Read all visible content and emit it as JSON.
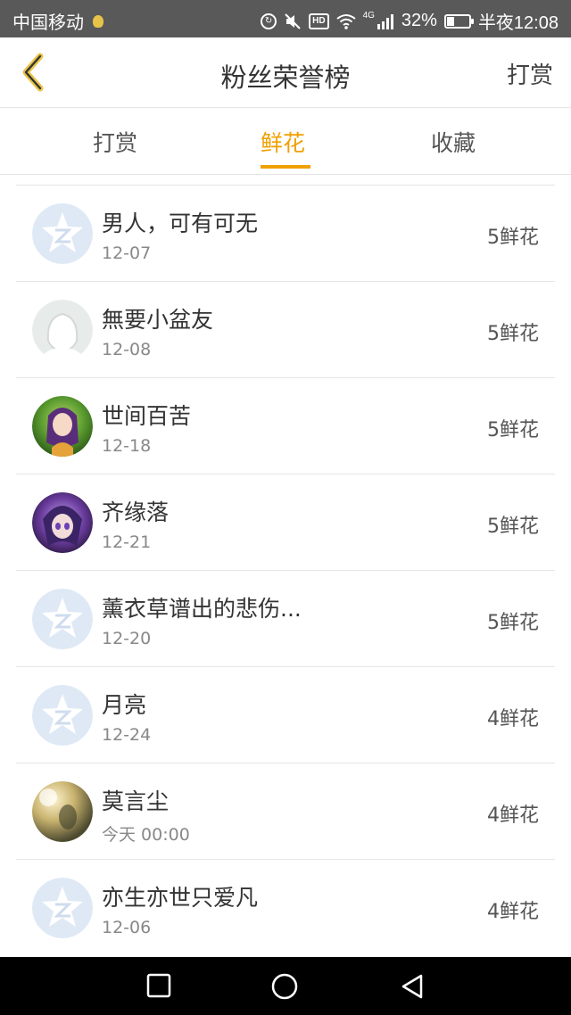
{
  "status_bar": {
    "carrier": "中国移动",
    "network": "4G",
    "battery": "32%",
    "battery_fraction": 0.32,
    "time": "半夜12:08"
  },
  "header": {
    "title": "粉丝荣誉榜",
    "right_action": "打赏"
  },
  "tabs": [
    {
      "label": "打赏",
      "active": false
    },
    {
      "label": "鲜花",
      "active": true
    },
    {
      "label": "收藏",
      "active": false
    }
  ],
  "list": [
    {
      "name": "男人，可有可无",
      "date": "12-07",
      "amount": "5鲜花",
      "avatar": "default-qq"
    },
    {
      "name": "無要小盆友",
      "date": "12-08",
      "amount": "5鲜花",
      "avatar": "silhouette"
    },
    {
      "name": "世间百苦",
      "date": "12-18",
      "amount": "5鲜花",
      "avatar": "anime-green"
    },
    {
      "name": "齐缘落",
      "date": "12-21",
      "amount": "5鲜花",
      "avatar": "anime-purple"
    },
    {
      "name": "薰衣草谱出的悲伤...",
      "date": "12-20",
      "amount": "5鲜花",
      "avatar": "default-qq"
    },
    {
      "name": "月亮",
      "date": "12-24",
      "amount": "4鲜花",
      "avatar": "default-qq"
    },
    {
      "name": "莫言尘",
      "date": "今天 00:00",
      "amount": "4鲜花",
      "avatar": "photo-warm"
    },
    {
      "name": "亦生亦世只爱凡",
      "date": "12-06",
      "amount": "4鲜花",
      "avatar": "default-qq"
    }
  ],
  "colors": {
    "accent": "#f0a000",
    "statusbar": "#595959",
    "divider": "#e6e6e6"
  }
}
